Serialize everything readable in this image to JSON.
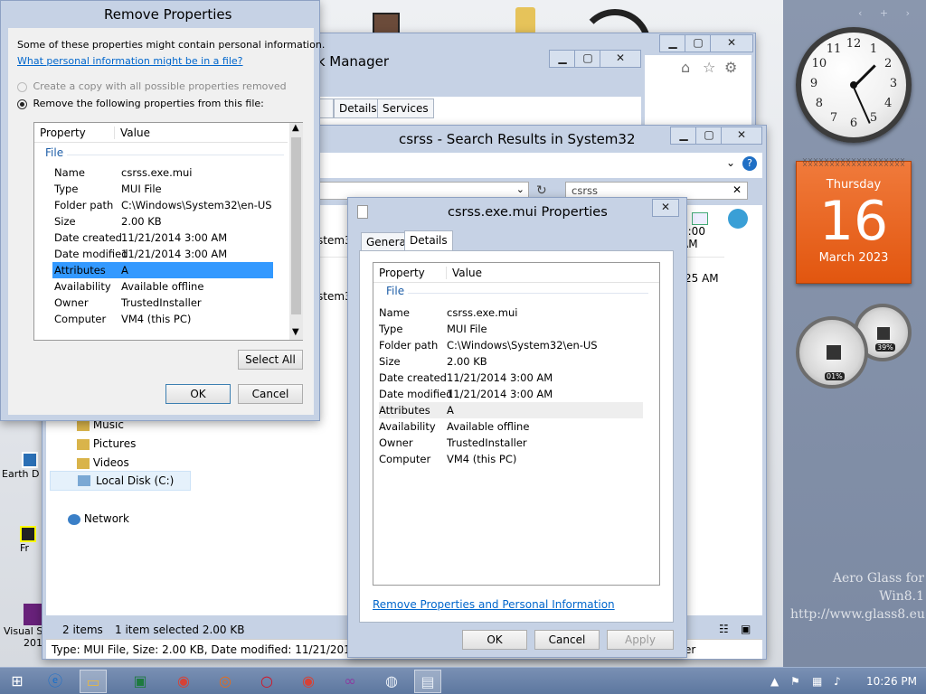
{
  "desktop": {
    "icons": [
      {
        "label": "Earth D"
      },
      {
        "label": "Fr"
      },
      {
        "label": "Visual S",
        "label2": "201"
      }
    ],
    "watermark": {
      "line1": "Aero Glass for Win8.1",
      "line2": "http://www.glass8.eu"
    }
  },
  "sidebar": {
    "nav": "‹ + ›",
    "clock": {
      "numbers": [
        "12",
        "1",
        "2",
        "3",
        "4",
        "5",
        "6",
        "7",
        "8",
        "9",
        "10",
        "11"
      ]
    },
    "calendar": {
      "weekday": "Thursday",
      "day": "16",
      "month_year": "March 2023"
    },
    "cpu_meter": {
      "cpu": "01%",
      "memory": "39%"
    }
  },
  "task_manager": {
    "title": "sk Manager",
    "tabs": [
      "rs",
      "Details",
      "Services"
    ]
  },
  "explorer": {
    "title": "csrss - Search Results in System32",
    "search_value": "csrss",
    "results": [
      {
        "name_frag": "stem3",
        "time_frag": "3:00 AM"
      },
      {
        "name_frag": "stem3",
        "time_frag": "25 AM"
      }
    ],
    "nav_items": [
      {
        "label": "Music"
      },
      {
        "label": "Pictures"
      },
      {
        "label": "Videos"
      },
      {
        "label": "Local Disk (C:)"
      },
      {
        "label": "Network"
      }
    ],
    "status": {
      "items": "2 items",
      "selected": "1 item selected  2.00 KB"
    },
    "details_bar": "Type: MUI File, Size: 2.00 KB, Date modified: 11/21/2014 3:00 AI",
    "details_bar_right": "er"
  },
  "properties": {
    "title": "csrss.exe.mui Properties",
    "tabs": [
      "General",
      "Details"
    ],
    "columns": [
      "Property",
      "Value"
    ],
    "group": "File",
    "rows": [
      {
        "prop": "Name",
        "value": "csrss.exe.mui"
      },
      {
        "prop": "Type",
        "value": "MUI File"
      },
      {
        "prop": "Folder path",
        "value": "C:\\Windows\\System32\\en-US"
      },
      {
        "prop": "Size",
        "value": "2.00 KB"
      },
      {
        "prop": "Date created",
        "value": "11/21/2014 3:00 AM"
      },
      {
        "prop": "Date modified",
        "value": "11/21/2014 3:00 AM"
      },
      {
        "prop": "Attributes",
        "value": "A"
      },
      {
        "prop": "Availability",
        "value": "Available offline"
      },
      {
        "prop": "Owner",
        "value": "TrustedInstaller"
      },
      {
        "prop": "Computer",
        "value": "VM4 (this PC)"
      }
    ],
    "remove_link": "Remove Properties and Personal Information",
    "ok": "OK",
    "cancel": "Cancel",
    "apply": "Apply"
  },
  "remove_dialog": {
    "title": "Remove Properties",
    "intro": "Some of these properties might contain personal information.",
    "link": "What personal information might be in a file?",
    "option1": "Create a copy with all possible properties removed",
    "option2": "Remove the following properties from this file:",
    "columns": [
      "Property",
      "Value"
    ],
    "group": "File",
    "rows": [
      {
        "prop": "Name",
        "value": "csrss.exe.mui"
      },
      {
        "prop": "Type",
        "value": "MUI File"
      },
      {
        "prop": "Folder path",
        "value": "C:\\Windows\\System32\\en-US"
      },
      {
        "prop": "Size",
        "value": "2.00 KB"
      },
      {
        "prop": "Date created",
        "value": "11/21/2014 3:00 AM"
      },
      {
        "prop": "Date modified",
        "value": "11/21/2014 3:00 AM"
      },
      {
        "prop": "Attributes",
        "value": "A",
        "selected": true
      },
      {
        "prop": "Availability",
        "value": "Available offline"
      },
      {
        "prop": "Owner",
        "value": "TrustedInstaller"
      },
      {
        "prop": "Computer",
        "value": "VM4 (this PC)"
      }
    ],
    "select_all": "Select All",
    "ok": "OK",
    "cancel": "Cancel"
  },
  "taskbar": {
    "time": "10:26 PM",
    "apps": [
      "start",
      "internet-explorer",
      "file-explorer",
      "excel",
      "chrome",
      "firefox",
      "opera",
      "chrome",
      "visual-studio",
      "globe",
      "system-properties"
    ]
  },
  "colors": {
    "selection": "#3399ff",
    "calendar": "#e8641f",
    "taskbar": "#6a84ad",
    "accent": "#0066cc"
  }
}
